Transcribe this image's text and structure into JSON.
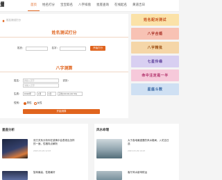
{
  "nav": {
    "logo": "量",
    "items": [
      "首页",
      "姓名打分",
      "宝宝取名",
      "八字排盘",
      "星座查询",
      "在线起名",
      "黄道吉日"
    ]
  },
  "breadcrumb": "姓名测试打分",
  "name_test": {
    "title": "姓名测试打分",
    "surname_label": "姓氏：",
    "given_label": "名字：",
    "submit": "开始打分"
  },
  "bazi": {
    "title": "八字测算",
    "name_label": "姓名：",
    "name_placeholder": "请输入汉字",
    "solar_label": "生辰：",
    "year": "1990年",
    "month": "1月",
    "day": "1日",
    "hour": "子时(00:00-00:59)",
    "gender_label": "性别：",
    "male": "男性",
    "female": "女性",
    "submit": "开始测算",
    "extra_label": "农历：",
    "extra_placeholder": "请输入汉字"
  },
  "banners": [
    {
      "text": "姓名配对测试",
      "bg": "#fbe2a8",
      "fg": "#c44a1a"
    },
    {
      "text": "八字合婚",
      "bg": "#f8c2b4",
      "fg": "#a82d23"
    },
    {
      "text": "八字精批",
      "bg": "#f5d6a8",
      "fg": "#9a4c10"
    },
    {
      "text": "七星伶缘",
      "bg": "#d8cff1",
      "fg": "#5a3d99"
    },
    {
      "text": "命中注定是一半",
      "bg": "#f6c9da",
      "fg": "#b0306a"
    },
    {
      "text": "星座斗数",
      "bg": "#cfe0f3",
      "fg": "#2f5f9e"
    }
  ],
  "left_section": {
    "title": "星座分析",
    "cards": [
      {
        "title": "双方关系分析你在感情中会表现出怎样的一面，性格特点解析",
        "meta": "2023-03-29 12:03"
      },
      {
        "title": "智商最高，性格最好",
        "meta": ""
      }
    ]
  },
  "right_section": {
    "title": "风水命理",
    "cards": [
      {
        "title": "大于各地最重要的风水格局，入宅吉日选",
        "meta": "2023-03-29 10:23"
      },
      {
        "title": "客厅风水影响财运",
        "meta": ""
      }
    ]
  }
}
